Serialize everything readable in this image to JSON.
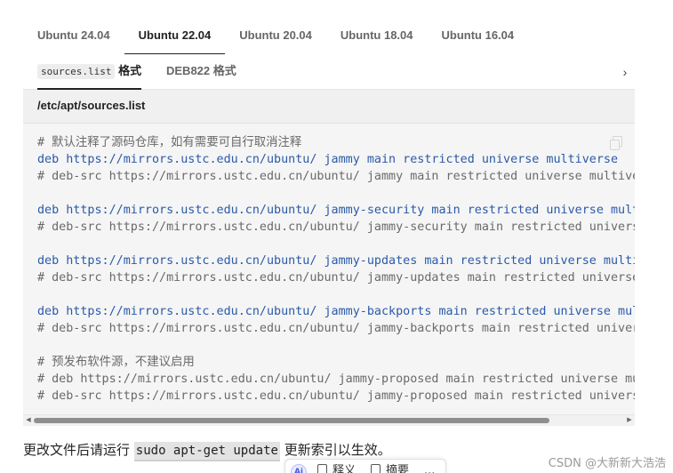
{
  "version_tabs": [
    {
      "label": "Ubuntu 24.04",
      "active": false
    },
    {
      "label": "Ubuntu 22.04",
      "active": true
    },
    {
      "label": "Ubuntu 20.04",
      "active": false
    },
    {
      "label": "Ubuntu 18.04",
      "active": false
    },
    {
      "label": "Ubuntu 16.04",
      "active": false
    }
  ],
  "format_tabs": {
    "sources_code": "sources.list",
    "sources_suffix": " 格式",
    "deb822": "DEB822 格式"
  },
  "file_path": "/etc/apt/sources.list",
  "code_lines": [
    {
      "text": "# 默认注释了源码仓库，如有需要可自行取消注释",
      "type": "comment"
    },
    {
      "text": "deb https://mirrors.ustc.edu.cn/ubuntu/ jammy main restricted universe multiverse",
      "type": "code"
    },
    {
      "text": "# deb-src https://mirrors.ustc.edu.cn/ubuntu/ jammy main restricted universe multiverse",
      "type": "comment"
    },
    {
      "text": "",
      "type": "blank"
    },
    {
      "text": "deb https://mirrors.ustc.edu.cn/ubuntu/ jammy-security main restricted universe multiverse",
      "type": "code"
    },
    {
      "text": "# deb-src https://mirrors.ustc.edu.cn/ubuntu/ jammy-security main restricted universe multiverse",
      "type": "comment"
    },
    {
      "text": "",
      "type": "blank"
    },
    {
      "text": "deb https://mirrors.ustc.edu.cn/ubuntu/ jammy-updates main restricted universe multiverse",
      "type": "code"
    },
    {
      "text": "# deb-src https://mirrors.ustc.edu.cn/ubuntu/ jammy-updates main restricted universe multiverse",
      "type": "comment"
    },
    {
      "text": "",
      "type": "blank"
    },
    {
      "text": "deb https://mirrors.ustc.edu.cn/ubuntu/ jammy-backports main restricted universe multiverse",
      "type": "code"
    },
    {
      "text": "# deb-src https://mirrors.ustc.edu.cn/ubuntu/ jammy-backports main restricted universe multiverse",
      "type": "comment"
    },
    {
      "text": "",
      "type": "blank"
    },
    {
      "text": "# 预发布软件源，不建议启用",
      "type": "comment"
    },
    {
      "text": "# deb https://mirrors.ustc.edu.cn/ubuntu/ jammy-proposed main restricted universe multiverse",
      "type": "comment"
    },
    {
      "text": "# deb-src https://mirrors.ustc.edu.cn/ubuntu/ jammy-proposed main restricted universe multiverse",
      "type": "comment"
    }
  ],
  "footer": {
    "before": "更改文件后请运行 ",
    "command": "sudo apt-get update",
    "after": " 更新索引以生效。"
  },
  "selection_toolbar": {
    "ai_label": "Ai",
    "item1": "释义",
    "item2": "摘要",
    "more": "..."
  },
  "watermark": "CSDN @大新新大浩浩",
  "icons": {
    "copy": "copy-icon",
    "chevron": "chevron-right-icon"
  },
  "colors": {
    "keyword": "#2a5aa8",
    "comment": "#6a6a6a",
    "code_bg": "#f5f5f5"
  }
}
